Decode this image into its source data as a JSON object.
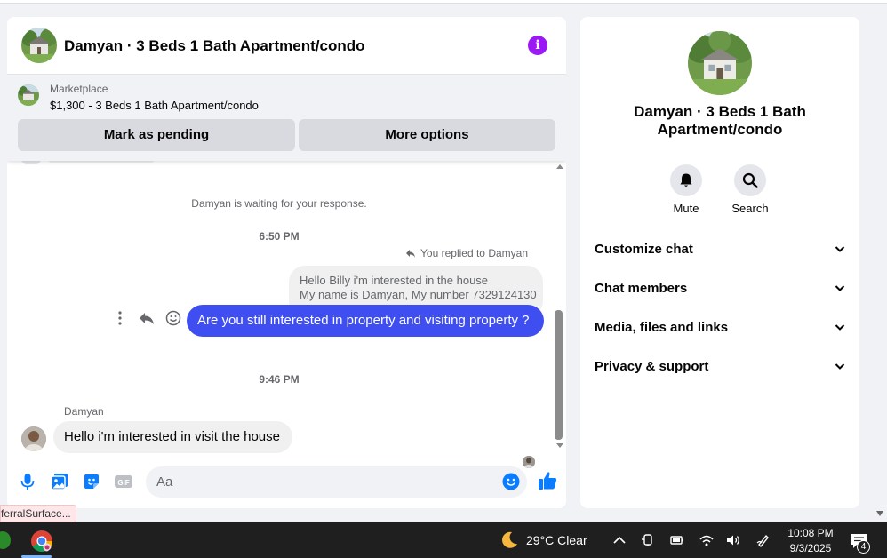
{
  "chat": {
    "title": "Damyan · 3 Beds 1 Bath Apartment/condo",
    "marketplace": {
      "label": "Marketplace",
      "listing": "$1,300 - 3 Beds 1 Bath Apartment/condo",
      "mark_pending_label": "Mark as pending",
      "more_options_label": "More options"
    },
    "messages": {
      "waiting_text": "Damyan is waiting for your response.",
      "time_1": "6:50 PM",
      "reply_note": "You replied to Damyan",
      "quoted_line_1": "Hello Billy i'm interested in the house",
      "quoted_line_2": "My name is Damyan, My number 7329124130",
      "outgoing": "Are you still interested in property and visiting property ?",
      "time_2": "9:46 PM",
      "sender_name": "Damyan",
      "incoming": "Hello i'm interested in visit the house"
    },
    "composer": {
      "placeholder": "Aa"
    }
  },
  "right_panel": {
    "name": "Damyan · 3 Beds 1 Bath Apartment/condo",
    "mute_label": "Mute",
    "search_label": "Search",
    "sections": [
      "Customize chat",
      "Chat members",
      "Media, files and links",
      "Privacy & support"
    ]
  },
  "tooltip": "ferralSurface...",
  "taskbar": {
    "weather": "29°C  Clear",
    "time": "10:08 PM",
    "date": "9/3/2025",
    "notifications": "4"
  },
  "colors": {
    "accent": "#9b19f5",
    "outgoing_bubble": "#3e4ef0",
    "messenger_blue": "#0a7cff"
  }
}
